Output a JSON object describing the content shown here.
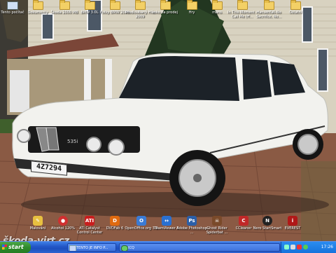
{
  "desktop": {
    "top_icons": [
      {
        "label": "Tento počítač",
        "icon": "computer-icon"
      },
      {
        "label": "Dokumenty",
        "icon": "folder-icon"
      },
      {
        "label": "Škoda 1000 MB",
        "icon": "folder-icon"
      },
      {
        "label": "BMW 3.0L",
        "icon": "folder-icon"
      },
      {
        "label": "Fotky BMW 2009",
        "icon": "folder-icon"
      },
      {
        "label": "Prodloubaný Hlíz 2009",
        "icon": "folder-icon"
      },
      {
        "label": "roko na prodej",
        "icon": "folder-icon"
      },
      {
        "label": "Hry",
        "icon": "folder-icon"
      },
      {
        "label": "mans",
        "icon": "folder-icon"
      },
      {
        "label": "In This Moment - Call Me (H...",
        "icon": "folder-icon"
      },
      {
        "label": "Hansenfall-No Sacrifice, No...",
        "icon": "folder-icon"
      },
      {
        "label": "Ostatní",
        "icon": "folder-icon"
      }
    ],
    "bottom_icons": [
      {
        "label": "Malování",
        "icon": "paint-icon",
        "color": "#e8c040"
      },
      {
        "label": "Alcohol 120%",
        "icon": "alcohol-icon",
        "color": "#d03030"
      },
      {
        "label": "ATI Catalyst Control Center",
        "icon": "ati-icon",
        "color": "#c81e1e"
      },
      {
        "label": "DVDFab 6",
        "icon": "dvdfab-icon",
        "color": "#e06a10"
      },
      {
        "label": "OpenOffice.org 3.0",
        "icon": "openoffice-icon",
        "color": "#3a7bd5"
      },
      {
        "label": "TeamViewer 3",
        "icon": "teamviewer-icon",
        "color": "#2a70d0"
      },
      {
        "label": "Adobe Photoshop ...",
        "icon": "photoshop-icon",
        "color": "#2b5fa8"
      },
      {
        "label": "Ghost Rider Spiderbat ...",
        "icon": "ghostrider-icon",
        "color": "#7a4a2a"
      },
      {
        "label": "CCleaner",
        "icon": "ccleaner-icon",
        "color": "#c02828"
      },
      {
        "label": "Nero StartSmart",
        "icon": "nero-icon",
        "color": "#222222"
      },
      {
        "label": "EVEREST",
        "icon": "everest-icon",
        "color": "#b01818"
      }
    ]
  },
  "watermark": "škoda-virt.cz",
  "car": {
    "plate": "4Z7294"
  },
  "taskbar": {
    "start_label": "start",
    "buttons": [
      {
        "label": "TENTO JE INFO P..."
      },
      {
        "label": "ICQ"
      }
    ],
    "clock": "17:26"
  },
  "colors": {
    "taskbar": "#2458c8",
    "start": "#2f8a2c",
    "tray": "#1573dc"
  }
}
